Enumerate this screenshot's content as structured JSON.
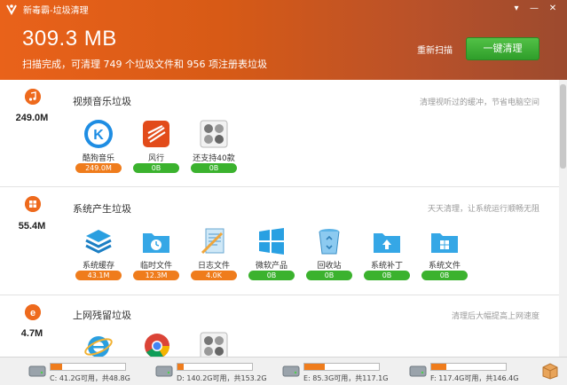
{
  "window": {
    "title": "新毒霸-垃圾清理"
  },
  "header": {
    "total_size": "309.3 MB",
    "summary": "扫描完成，可清理 749 个垃圾文件和 956 项注册表垃圾",
    "rescan_label": "重新扫描",
    "clean_label": "一键清理"
  },
  "sections": [
    {
      "title": "视频音乐垃圾",
      "size": "249.0M",
      "hint": "清理视听过的缓冲，节省电脑空间",
      "items": [
        {
          "label": "酷狗音乐",
          "value": "249.0M"
        },
        {
          "label": "风行",
          "value": "0B"
        },
        {
          "label": "还支持40款",
          "value": "0B"
        }
      ]
    },
    {
      "title": "系统产生垃圾",
      "size": "55.4M",
      "hint": "天天清理，让系统运行顺畅无阻",
      "items": [
        {
          "label": "系统缓存",
          "value": "43.1M"
        },
        {
          "label": "临时文件",
          "value": "12.3M"
        },
        {
          "label": "日志文件",
          "value": "4.0K"
        },
        {
          "label": "微软产品",
          "value": "0B"
        },
        {
          "label": "回收站",
          "value": "0B"
        },
        {
          "label": "系统补丁",
          "value": "0B"
        },
        {
          "label": "系统文件",
          "value": "0B"
        }
      ]
    },
    {
      "title": "上网残留垃圾",
      "size": "4.7M",
      "hint": "清理后大幅提高上网速度",
      "items": []
    }
  ],
  "drives": [
    {
      "label": "C: 41.2G可用，共48.8G",
      "used_fraction": 0.16
    },
    {
      "label": "D: 140.2G可用，共153.2G",
      "used_fraction": 0.08
    },
    {
      "label": "E: 85.3G可用，共117.1G",
      "used_fraction": 0.27
    },
    {
      "label": "F: 117.4G可用，共146.4G",
      "used_fraction": 0.2
    }
  ],
  "colors": {
    "accent": "#ee6a1d",
    "green": "#3bb22e",
    "header_start": "#e9621a",
    "header_end": "#9c4a2e"
  }
}
